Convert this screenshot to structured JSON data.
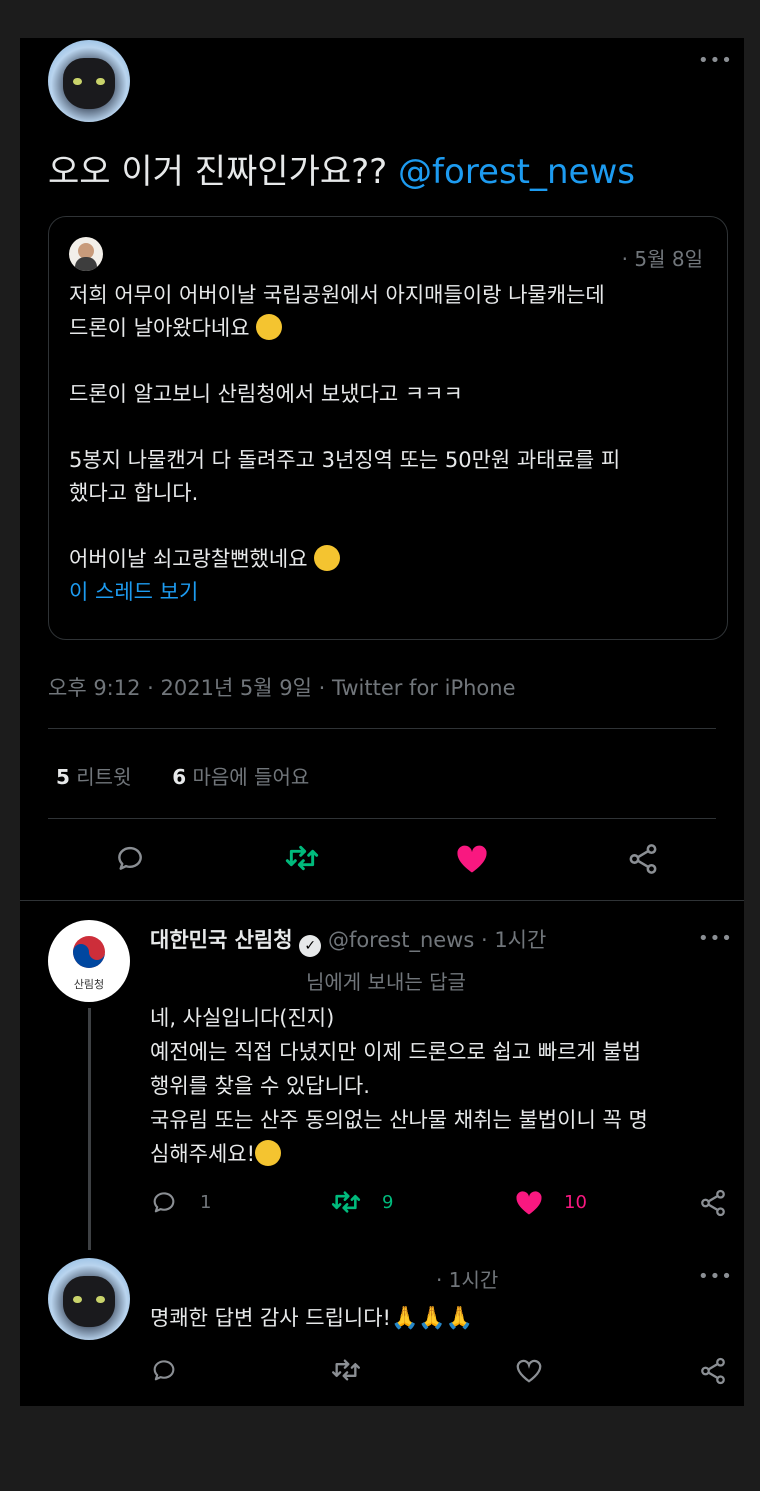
{
  "main_tweet": {
    "text": "오오 이거 진짜인가요?? ",
    "mention": "@forest_news",
    "quoted": {
      "date": "· 5월 8일",
      "line1": "저희 어무이 어버이날 국립공원에서 아지매들이랑 나물캐는데",
      "line2": "드론이 날아왔다네요",
      "line3": "드론이 알고보니 산림청에서 보냈다고 ㅋㅋㅋ",
      "line4": "5봉지 나물캔거 다 돌려주고 3년징역 또는 50만원 과태료를 피",
      "line5": "했다고 합니다.",
      "line6": "어버이날 쇠고랑찰뻔했네요",
      "show_thread": "이 스레드 보기"
    },
    "meta": "오후 9:12 · 2021년 5월 9일 · Twitter for iPhone",
    "retweet_count": "5",
    "retweet_label": "리트윗",
    "like_count": "6",
    "like_label": "마음에 들어요"
  },
  "reply1": {
    "name": "대한민국 산림청",
    "handle": "@forest_news · 1시간",
    "avatar_text": "산림청",
    "replying_to": "님에게 보내는 답글",
    "line1": "네, 사실입니다(진지)",
    "line2": "예전에는 직접 다녔지만 이제 드론으로 쉽고 빠르게 불법",
    "line3": "행위를 찾을 수 있답니다.",
    "line4": "국유림 또는 산주 동의없는 산나물 채취는 불법이니 꼭 명",
    "line5": "심해주세요!",
    "reply_count": "1",
    "retweet_count": "9",
    "like_count": "10"
  },
  "reply2": {
    "time": "· 1시간",
    "text": "명쾌한 답변 감사 드립니다!"
  },
  "colors": {
    "link": "#1d9bf0",
    "retweet": "#00ba7c",
    "like": "#f91880",
    "bg": "#000000"
  }
}
